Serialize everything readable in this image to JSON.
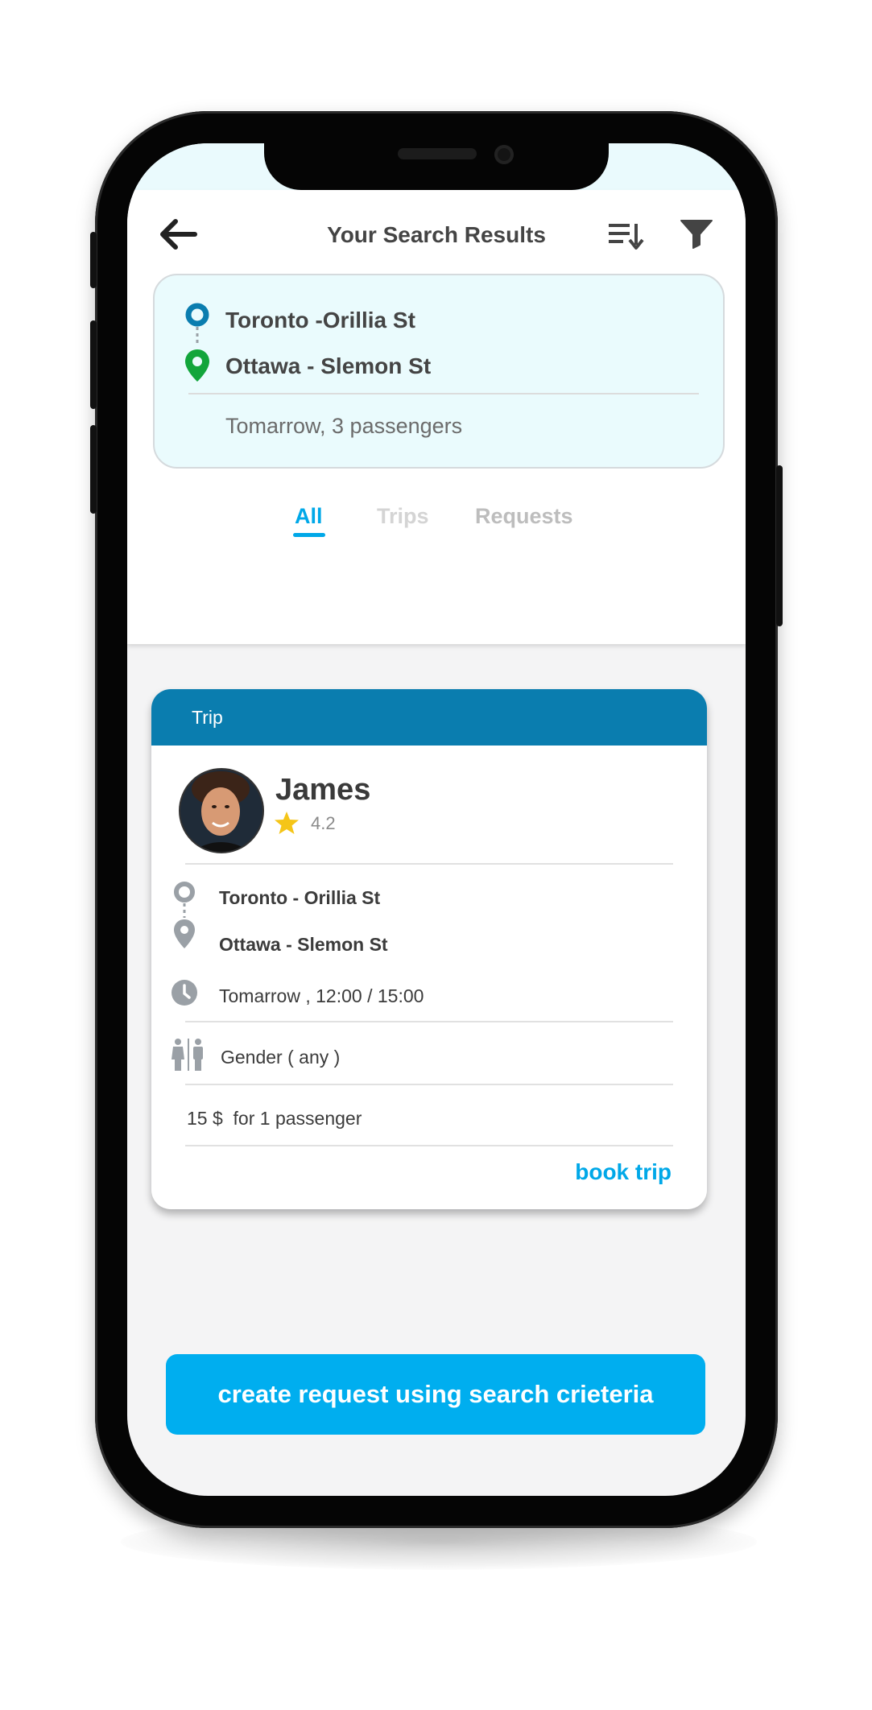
{
  "header": {
    "title": "Your Search Results",
    "back_icon": "arrow-left-icon",
    "sort_icon": "sort-descending-icon",
    "filter_icon": "filter-icon"
  },
  "search": {
    "from": "Toronto -Orillia St",
    "to": "Ottawa - Slemon St",
    "summary": "Tomarrow, 3 passengers"
  },
  "tabs": [
    {
      "label": "All",
      "active": true
    },
    {
      "label": "Trips",
      "active": false
    },
    {
      "label": "Requests",
      "active": false
    }
  ],
  "results": [
    {
      "type_label": "Trip",
      "driver": {
        "name": "James",
        "rating": "4.2"
      },
      "from": "Toronto - Orillia St",
      "to": "Ottawa - Slemon St",
      "time": "Tomarrow , 12:00 / 15:00",
      "gender": "Gender ( any )",
      "price": "15 $  for 1 passenger",
      "action_label": "book trip"
    }
  ],
  "cta": {
    "label": "create request using search crieteria"
  },
  "colors": {
    "accent": "#00aeef",
    "card_header": "#0a7daf",
    "origin_pin": "#0a7daf",
    "destination_pin": "#12a53b",
    "search_box_bg": "#eafbfd",
    "star": "#f5c518"
  }
}
